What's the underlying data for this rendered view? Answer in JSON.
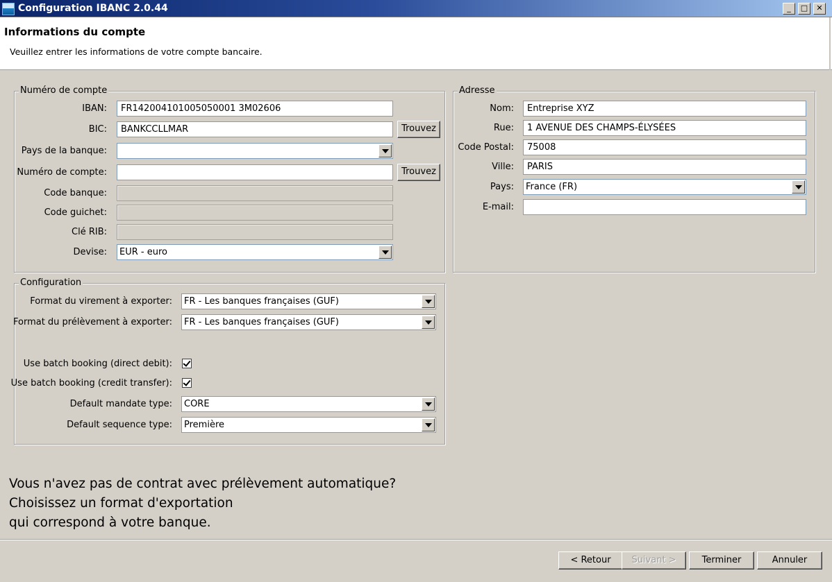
{
  "window": {
    "title": "Configuration IBANC 2.0.44",
    "controls": {
      "minimize": "_",
      "maximize": "□",
      "close": "✕"
    }
  },
  "header": {
    "title": "Informations du compte",
    "subtitle": "Veuillez entrer les informations de votre compte bancaire."
  },
  "account": {
    "legend": "Numéro de compte",
    "iban_label": "IBAN:",
    "iban_value": "FR142004101005050001 3M02606",
    "bic_label": "BIC:",
    "bic_value": "BANKCCLLMAR",
    "find_label": "Trouvez",
    "bank_country_label": "Pays de la banque:",
    "bank_country_value": "",
    "account_number_label": "Numéro de compte:",
    "account_number_value": "",
    "bank_code_label": "Code banque:",
    "branch_code_label": "Code guichet:",
    "rib_key_label": "Clé RIB:",
    "currency_label": "Devise:",
    "currency_value": "EUR - euro"
  },
  "address": {
    "legend": "Adresse",
    "name_label": "Nom:",
    "name_value": "Entreprise XYZ",
    "street_label": "Rue:",
    "street_value": "1 AVENUE DES CHAMPS-ÉLYSÉES",
    "postal_label": "Code Postal:",
    "postal_value": "75008",
    "city_label": "Ville:",
    "city_value": "PARIS",
    "country_label": "Pays:",
    "country_value": "France (FR)",
    "email_label": "E-mail:",
    "email_value": ""
  },
  "config": {
    "legend": "Configuration",
    "transfer_format_label": "Format du virement à exporter:",
    "transfer_format_value": "FR - Les banques françaises (GUF)",
    "debit_format_label": "Format du prélèvement à exporter:",
    "debit_format_value": "FR - Les banques françaises (GUF)",
    "batch_debit_label": "Use batch booking (direct debit):",
    "batch_debit_checked": true,
    "batch_credit_label": "Use batch booking (credit transfer):",
    "batch_credit_checked": true,
    "mandate_label": "Default mandate type:",
    "mandate_value": "CORE",
    "sequence_label": "Default sequence type:",
    "sequence_value": "Première"
  },
  "note": {
    "line1": "Vous n'avez pas de contrat avec prélèvement automatique?",
    "line2": "Choisissez un format d'exportation",
    "line3": "qui correspond à votre banque."
  },
  "footer": {
    "back_label": "< Retour",
    "next_label": "Suivant >",
    "finish_label": "Terminer",
    "cancel_label": "Annuler"
  }
}
